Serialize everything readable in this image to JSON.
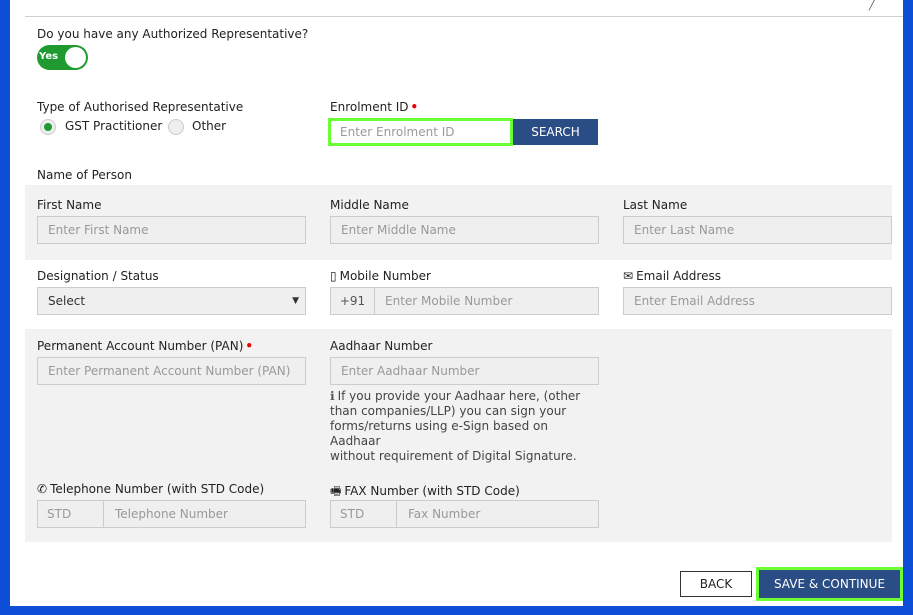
{
  "question": "Do you have any Authorized Representative?",
  "toggle": {
    "label": "Yes"
  },
  "rep_type": {
    "label": "Type of Authorised Representative",
    "options": [
      "GST Practitioner",
      "Other"
    ],
    "selected": "GST Practitioner"
  },
  "enrolment": {
    "label": "Enrolment ID",
    "placeholder": "Enter Enrolment ID",
    "search_label": "SEARCH"
  },
  "name_section": "Name of Person",
  "first_name": {
    "label": "First Name",
    "placeholder": "Enter First Name"
  },
  "middle_name": {
    "label": "Middle Name",
    "placeholder": "Enter Middle Name"
  },
  "last_name": {
    "label": "Last Name",
    "placeholder": "Enter Last Name"
  },
  "designation": {
    "label": "Designation / Status",
    "value": "Select"
  },
  "mobile": {
    "label": "Mobile Number",
    "prefix": "+91",
    "placeholder": "Enter Mobile Number",
    "icon": "mobile-icon"
  },
  "email": {
    "label": "Email Address",
    "placeholder": "Enter Email Address",
    "icon": "envelope-icon"
  },
  "pan": {
    "label": "Permanent Account Number (PAN)",
    "placeholder": "Enter Permanent Account Number (PAN)"
  },
  "aadhaar": {
    "label": "Aadhaar Number",
    "placeholder": "Enter Aadhaar Number",
    "help_lines": [
      "If you provide your Aadhaar here, (other",
      "than companies/LLP) you can sign your",
      "forms/returns using e-Sign based on Aadhaar",
      "without requirement of Digital Signature."
    ]
  },
  "telephone": {
    "label": "Telephone Number (with STD Code)",
    "std": "STD",
    "placeholder": "Telephone Number",
    "icon": "phone-icon"
  },
  "fax": {
    "label": "FAX Number (with STD Code)",
    "std": "STD",
    "placeholder": "Fax Number",
    "icon": "fax-icon"
  },
  "buttons": {
    "back": "BACK",
    "save": "SAVE & CONTINUE"
  },
  "colors": {
    "accent": "#2b4d86",
    "highlight": "#6cff33",
    "toggle": "#1f9a31",
    "frame": "#0d4fd6"
  }
}
